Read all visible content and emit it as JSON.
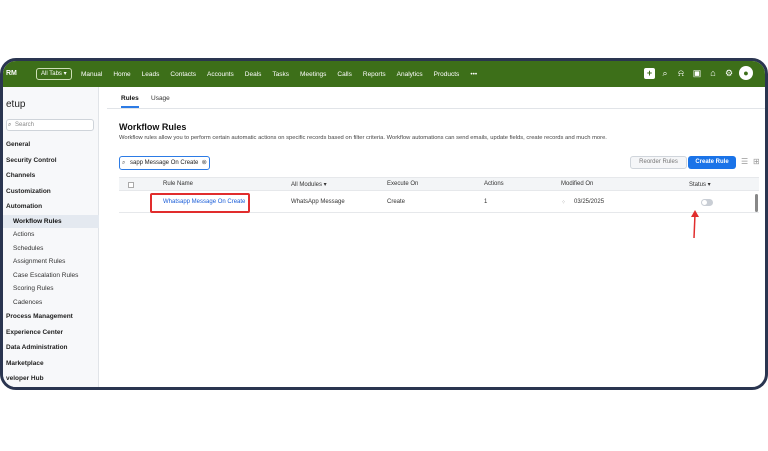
{
  "app": {
    "brand": "RM",
    "all_tabs": "All Tabs"
  },
  "nav": [
    "Manual",
    "Home",
    "Leads",
    "Contacts",
    "Accounts",
    "Deals",
    "Tasks",
    "Meetings",
    "Calls",
    "Reports",
    "Analytics",
    "Products",
    "•••"
  ],
  "sidebar": {
    "title": "etup",
    "search_placeholder": "Search",
    "items": [
      {
        "label": "General",
        "type": "sec"
      },
      {
        "label": "Security Control",
        "type": "sec"
      },
      {
        "label": "Channels",
        "type": "sec"
      },
      {
        "label": "Customization",
        "type": "sec"
      },
      {
        "label": "Automation",
        "type": "sec"
      },
      {
        "label": "Workflow Rules",
        "type": "sub active"
      },
      {
        "label": "Actions",
        "type": "sub"
      },
      {
        "label": "Schedules",
        "type": "sub"
      },
      {
        "label": "Assignment Rules",
        "type": "sub"
      },
      {
        "label": "Case Escalation Rules",
        "type": "sub"
      },
      {
        "label": "Scoring Rules",
        "type": "sub"
      },
      {
        "label": "Cadences",
        "type": "sub"
      },
      {
        "label": "Process Management",
        "type": "sec"
      },
      {
        "label": "Experience Center",
        "type": "sec"
      },
      {
        "label": "Data Administration",
        "type": "sec"
      },
      {
        "label": "Marketplace",
        "type": "sec"
      },
      {
        "label": "veloper Hub",
        "type": "sec"
      }
    ]
  },
  "tabs": {
    "rules": "Rules",
    "usage": "Usage"
  },
  "page": {
    "title": "Workflow Rules",
    "description": "Workflow rules allow you to perform certain automatic actions on specific records based on filter criteria. Workflow automations can send emails, update fields, create records and much more."
  },
  "search": {
    "value": "sapp Message On Create"
  },
  "buttons": {
    "reorder": "Reorder Rules",
    "create": "Create Rule"
  },
  "table": {
    "headers": {
      "rule_name": "Rule Name",
      "modules": "All Modules",
      "execute_on": "Execute On",
      "actions": "Actions",
      "modified_on": "Modified On",
      "status": "Status"
    },
    "row": {
      "rule_name": "Whatsapp Message On Create",
      "module": "WhatsApp Message",
      "execute_on": "Create",
      "actions": "1",
      "modified_on": "03/25/2025"
    }
  },
  "colors": {
    "header_green": "#3d6f19",
    "primary_blue": "#1a73e8",
    "highlight_red": "#e12d2d"
  }
}
